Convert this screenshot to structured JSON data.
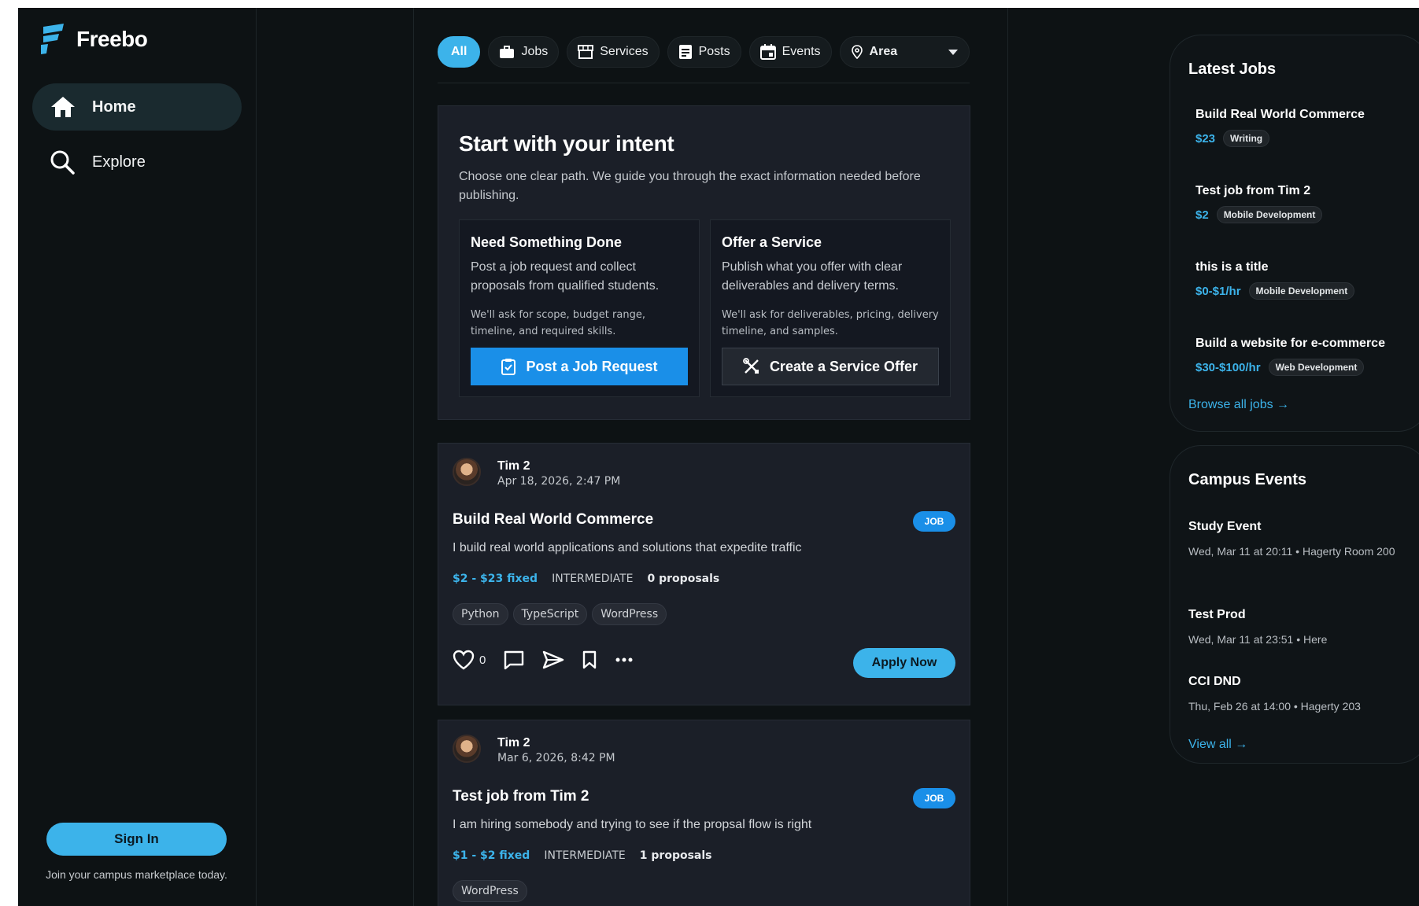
{
  "app": {
    "name": "Freebo"
  },
  "nav": {
    "items": [
      {
        "label": "Home",
        "icon": "home-icon",
        "active": true
      },
      {
        "label": "Explore",
        "icon": "search-icon",
        "active": false
      }
    ]
  },
  "auth": {
    "signin_label": "Sign In",
    "note": "Join your campus marketplace today."
  },
  "filters": [
    {
      "label": "All",
      "icon": null,
      "active": true
    },
    {
      "label": "Jobs",
      "icon": "briefcase-icon"
    },
    {
      "label": "Services",
      "icon": "storefront-icon"
    },
    {
      "label": "Posts",
      "icon": "document-icon"
    },
    {
      "label": "Events",
      "icon": "calendar-icon"
    },
    {
      "label": "Area",
      "icon": "location-pin-icon"
    }
  ],
  "intent": {
    "title": "Start with your intent",
    "description": "Choose one clear path. We guide you through the exact information needed before publishing.",
    "options": [
      {
        "title": "Need Something Done",
        "description": "Post a job request and collect proposals from qualified students.",
        "note": "We'll ask for scope, budget range, timeline, and required skills.",
        "button": "Post a Job Request"
      },
      {
        "title": "Offer a Service",
        "description": "Publish what you offer with clear deliverables and delivery terms.",
        "note": "We'll ask for deliverables, pricing, delivery timeline, and samples.",
        "button": "Create a Service Offer"
      }
    ]
  },
  "posts": [
    {
      "author": "Tim 2",
      "date": "Apr 18, 2026, 2:47 PM",
      "title": "Build Real World Commerce",
      "badge": "JOB",
      "description": "I build real world applications and solutions that expedite traffic",
      "price": "$2 - $23 fixed",
      "level": "INTERMEDIATE",
      "proposals": "0 proposals",
      "tags": [
        "Python",
        "TypeScript",
        "WordPress"
      ],
      "likes": "0",
      "apply_label": "Apply Now"
    },
    {
      "author": "Tim 2",
      "date": "Mar 6, 2026, 8:42 PM",
      "title": "Test job from Tim 2",
      "badge": "JOB",
      "description": "I am hiring somebody and trying to see if the propsal flow is right",
      "price": "$1 - $2 fixed",
      "level": "INTERMEDIATE",
      "proposals": "1 proposals",
      "tags": [
        "WordPress"
      ]
    }
  ],
  "latest_jobs": {
    "title": "Latest Jobs",
    "items": [
      {
        "title": "Build Real World Commerce",
        "price": "$23",
        "tag": "Writing"
      },
      {
        "title": "Test job from Tim 2",
        "price": "$2",
        "tag": "Mobile Development"
      },
      {
        "title": "this is a title",
        "price": "$0-$1/hr",
        "tag": "Mobile Development"
      },
      {
        "title": "Build a website for e-commerce",
        "price": "$30-$100/hr",
        "tag": "Web Development"
      }
    ],
    "link": "Browse all jobs →"
  },
  "campus_events": {
    "title": "Campus Events",
    "items": [
      {
        "title": "Study Event",
        "subtitle": "Wed, Mar 11 at 20:11 • Hagerty Room 200"
      },
      {
        "title": "Test Prod",
        "subtitle": "Wed, Mar 11 at 23:51 • Here"
      },
      {
        "title": "CCI DND",
        "subtitle": "Thu, Feb 26 at 14:00 • Hagerty 203"
      }
    ],
    "link": "View all →"
  },
  "colors": {
    "accent": "#3cb3ea",
    "primary_button": "#1a8fe8",
    "background": "#0d1214",
    "card": "#1b1f28"
  }
}
